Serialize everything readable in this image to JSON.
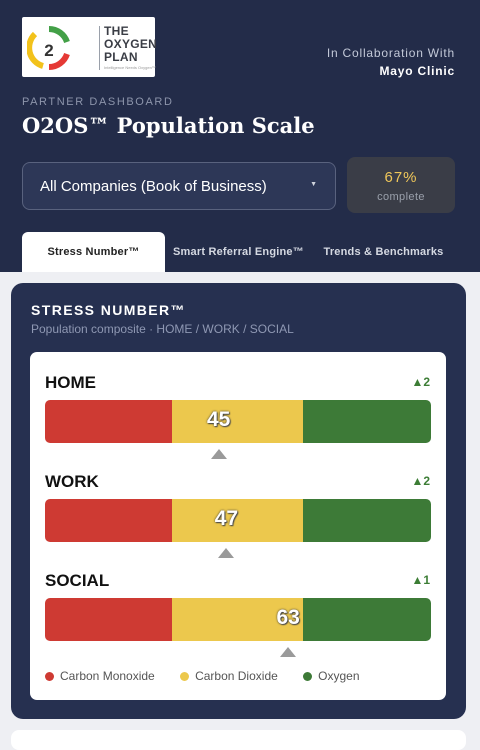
{
  "brand": {
    "logo_text": [
      "THE",
      "OXYGEN",
      "PLAN"
    ],
    "logo_number": "2",
    "logo_tagline": "Intelligence Needs Oxygen™",
    "collab_line1": "In Collaboration With",
    "collab_line2": "Mayo Clinic"
  },
  "header": {
    "eyebrow": "PARTNER DASHBOARD",
    "title": "O2OS™ Population Scale"
  },
  "company_select": {
    "value": "All Companies (Book of Business)",
    "caret": "▼"
  },
  "completion": {
    "value": "67%",
    "label": "complete",
    "fraction": 0.67
  },
  "tabs": [
    {
      "label": "Stress Number™",
      "active": true
    },
    {
      "label": "Smart Referral Engine™",
      "active": false
    },
    {
      "label": "Trends & Benchmarks",
      "active": false
    }
  ],
  "panel": {
    "title": "STRESS NUMBER™",
    "subtitle": "Population composite · HOME / WORK / SOCIAL"
  },
  "scale": {
    "min": 0,
    "max": 100
  },
  "rows": [
    {
      "label": "HOME",
      "score": 45,
      "score_text": "45",
      "delta": "▲2"
    },
    {
      "label": "WORK",
      "score": 47,
      "score_text": "47",
      "delta": "▲2"
    },
    {
      "label": "SOCIAL",
      "score": 63,
      "score_text": "63",
      "delta": "▲1"
    }
  ],
  "legend": [
    {
      "label": "Carbon Monoxide",
      "color": "#ce3a33"
    },
    {
      "label": "Carbon Dioxide",
      "color": "#ecc84d"
    },
    {
      "label": "Oxygen",
      "color": "#3d7a37"
    }
  ],
  "colors": {
    "header_bg": "#232c49",
    "panel_bg": "#263050",
    "accent_yellow": "#efc75a",
    "delta_green": "#3c7d35"
  }
}
